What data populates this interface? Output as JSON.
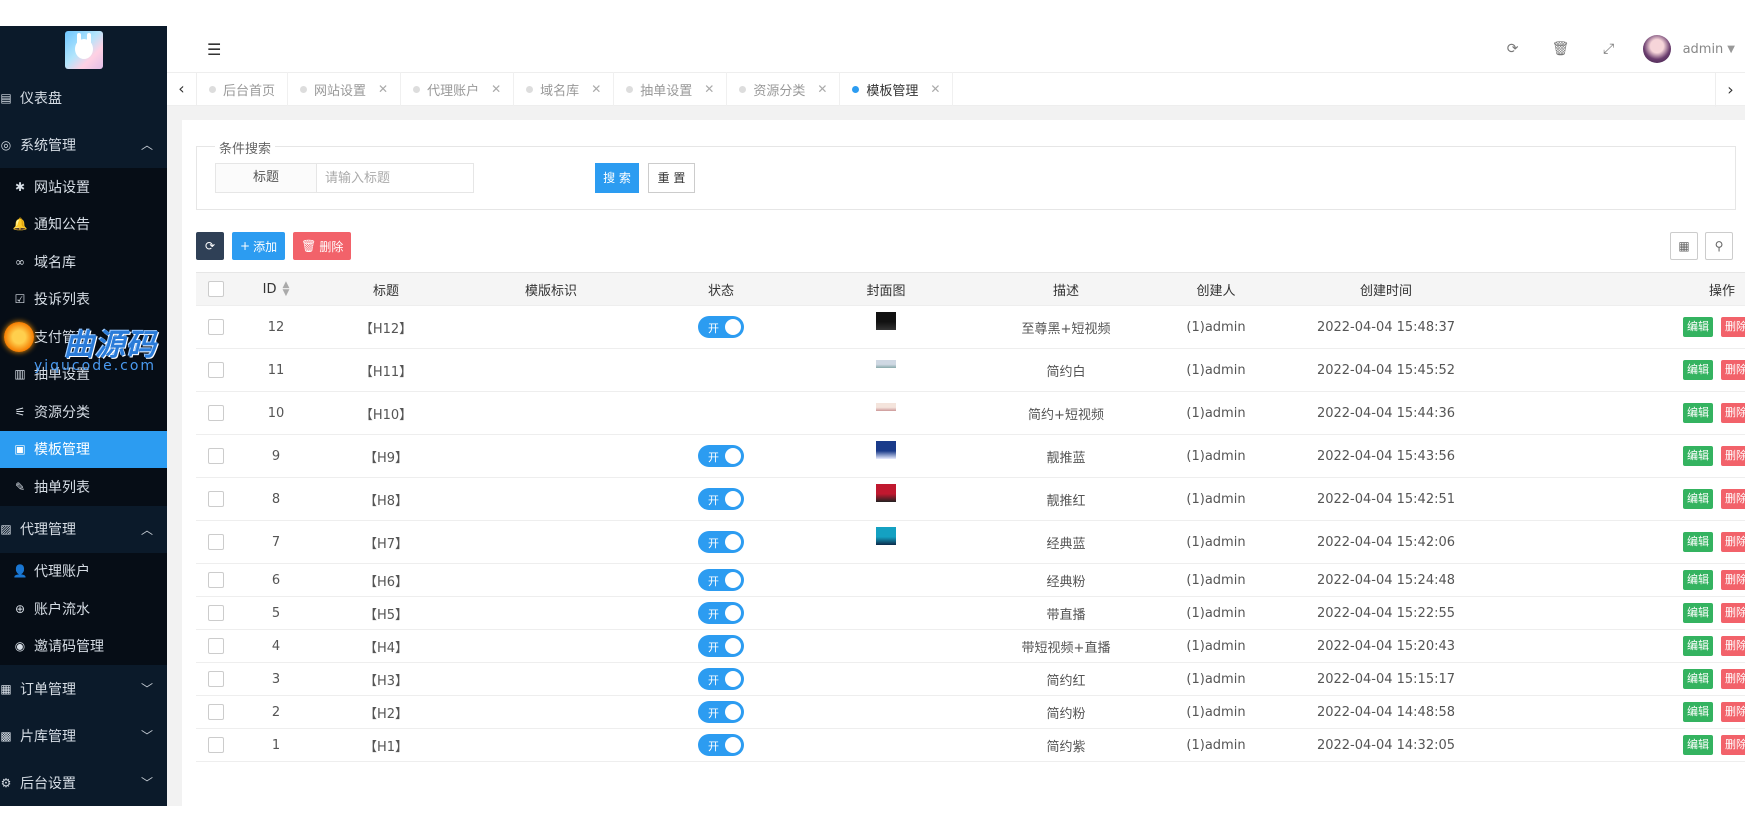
{
  "sidebar": {
    "items": [
      {
        "label": "仪表盘",
        "icon": "dashboard-icon"
      },
      {
        "label": "系统管理",
        "icon": "settings-circle-icon",
        "expanded": true,
        "children": [
          {
            "label": "网站设置",
            "icon": "asterisk-icon"
          },
          {
            "label": "通知公告",
            "icon": "bell-icon"
          },
          {
            "label": "域名库",
            "icon": "link-icon"
          },
          {
            "label": "投诉列表",
            "icon": "check-square-icon"
          },
          {
            "label": "支付管理",
            "icon": "payment-icon"
          },
          {
            "label": "抽单设置",
            "icon": "bank-icon"
          },
          {
            "label": "资源分类",
            "icon": "tags-icon"
          },
          {
            "label": "模板管理",
            "icon": "html5-icon",
            "active": true
          },
          {
            "label": "抽单列表",
            "icon": "pen-icon"
          }
        ]
      },
      {
        "label": "代理管理",
        "icon": "address-card-icon",
        "expanded": true,
        "children": [
          {
            "label": "代理账户",
            "icon": "user-icon"
          },
          {
            "label": "账户流水",
            "icon": "arrow-circle-icon"
          },
          {
            "label": "邀请码管理",
            "icon": "eye-icon"
          }
        ]
      },
      {
        "label": "订单管理",
        "icon": "order-icon"
      },
      {
        "label": "片库管理",
        "icon": "film-icon"
      },
      {
        "label": "后台设置",
        "icon": "cogs-icon"
      }
    ],
    "watermark": {
      "main": "曲源码",
      "sub": "yiqucode.com"
    }
  },
  "header": {
    "user": "admin"
  },
  "tabs": [
    {
      "label": "后台首页",
      "closable": false
    },
    {
      "label": "网站设置",
      "closable": true
    },
    {
      "label": "代理账户",
      "closable": true
    },
    {
      "label": "域名库",
      "closable": true
    },
    {
      "label": "抽单设置",
      "closable": true
    },
    {
      "label": "资源分类",
      "closable": true
    },
    {
      "label": "模板管理",
      "closable": true,
      "active": true
    }
  ],
  "search": {
    "legend": "条件搜索",
    "field_label": "标题",
    "placeholder": "请输入标题",
    "search_btn": "搜 索",
    "reset_btn": "重 置"
  },
  "toolbar": {
    "add": "添加",
    "delete": "删除"
  },
  "table": {
    "columns": [
      "ID",
      "标题",
      "模版标识",
      "状态",
      "封面图",
      "描述",
      "创建人",
      "创建时间",
      "操作"
    ],
    "switch_label": "开",
    "edit_label": "编辑",
    "delete_label": "删除",
    "rows": [
      {
        "id": "12",
        "title": "【H12】",
        "status": true,
        "cover": "dark",
        "desc": "至尊黑+短视频",
        "creator": "(1)admin",
        "time": "2022-04-04 15:48:37"
      },
      {
        "id": "11",
        "title": "【H11】",
        "status": false,
        "cover": "light",
        "desc": "简约白",
        "creator": "(1)admin",
        "time": "2022-04-04 15:45:52"
      },
      {
        "id": "10",
        "title": "【H10】",
        "status": false,
        "cover": "light2",
        "desc": "简约+短视频",
        "creator": "(1)admin",
        "time": "2022-04-04 15:44:36"
      },
      {
        "id": "9",
        "title": "【H9】",
        "status": true,
        "cover": "blue",
        "desc": "靓推蓝",
        "creator": "(1)admin",
        "time": "2022-04-04 15:43:56"
      },
      {
        "id": "8",
        "title": "【H8】",
        "status": true,
        "cover": "red",
        "desc": "靓推红",
        "creator": "(1)admin",
        "time": "2022-04-04 15:42:51"
      },
      {
        "id": "7",
        "title": "【H7】",
        "status": true,
        "cover": "teal",
        "desc": "经典蓝",
        "creator": "(1)admin",
        "time": "2022-04-04 15:42:06"
      },
      {
        "id": "6",
        "title": "【H6】",
        "status": true,
        "cover": "",
        "desc": "经典粉",
        "creator": "(1)admin",
        "time": "2022-04-04 15:24:48"
      },
      {
        "id": "5",
        "title": "【H5】",
        "status": true,
        "cover": "",
        "desc": "带直播",
        "creator": "(1)admin",
        "time": "2022-04-04 15:22:55"
      },
      {
        "id": "4",
        "title": "【H4】",
        "status": true,
        "cover": "",
        "desc": "带短视频+直播",
        "creator": "(1)admin",
        "time": "2022-04-04 15:20:43"
      },
      {
        "id": "3",
        "title": "【H3】",
        "status": true,
        "cover": "",
        "desc": "简约红",
        "creator": "(1)admin",
        "time": "2022-04-04 15:15:17"
      },
      {
        "id": "2",
        "title": "【H2】",
        "status": true,
        "cover": "",
        "desc": "简约粉",
        "creator": "(1)admin",
        "time": "2022-04-04 14:48:58"
      },
      {
        "id": "1",
        "title": "【H1】",
        "status": true,
        "cover": "",
        "desc": "简约紫",
        "creator": "(1)admin",
        "time": "2022-04-04 14:32:05"
      }
    ]
  }
}
